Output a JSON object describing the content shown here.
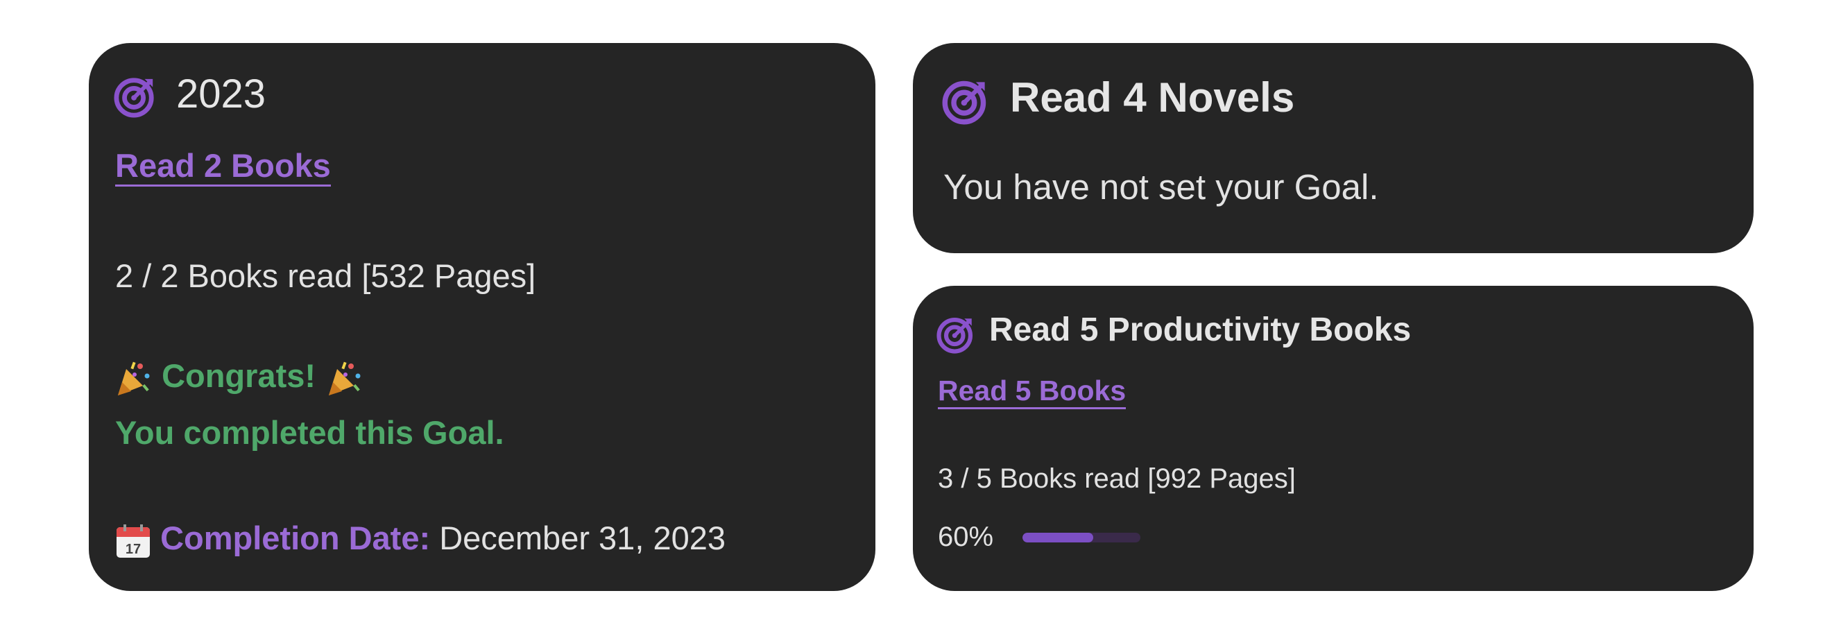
{
  "colors": {
    "card_background": "#252525",
    "accent_purple": "#9b6bd6",
    "success_green": "#4fa86a",
    "progress_fill": "#7c4fc4",
    "progress_track": "#3a2a4a"
  },
  "goal_2023": {
    "icon": "target-icon",
    "title": "2023",
    "goal_link": "Read 2 Books",
    "books_read": "2 / 2 Books read [532 Pages]",
    "congrats_icon": "party-popper-icon",
    "congrats": "Congrats!",
    "completed_message": "You completed this Goal.",
    "calendar_icon": "calendar-icon",
    "completion_label": "Completion Date:",
    "completion_date": "December 31, 2023"
  },
  "goal_novels": {
    "icon": "target-icon",
    "title": "Read 4 Novels",
    "message": "You have not set your Goal."
  },
  "goal_productivity": {
    "icon": "target-icon",
    "title": "Read 5 Productivity Books",
    "goal_link": "Read 5 Books",
    "books_read": "3 / 5 Books read [992 Pages]",
    "progress_label": "60%",
    "progress_value": 0.6
  }
}
